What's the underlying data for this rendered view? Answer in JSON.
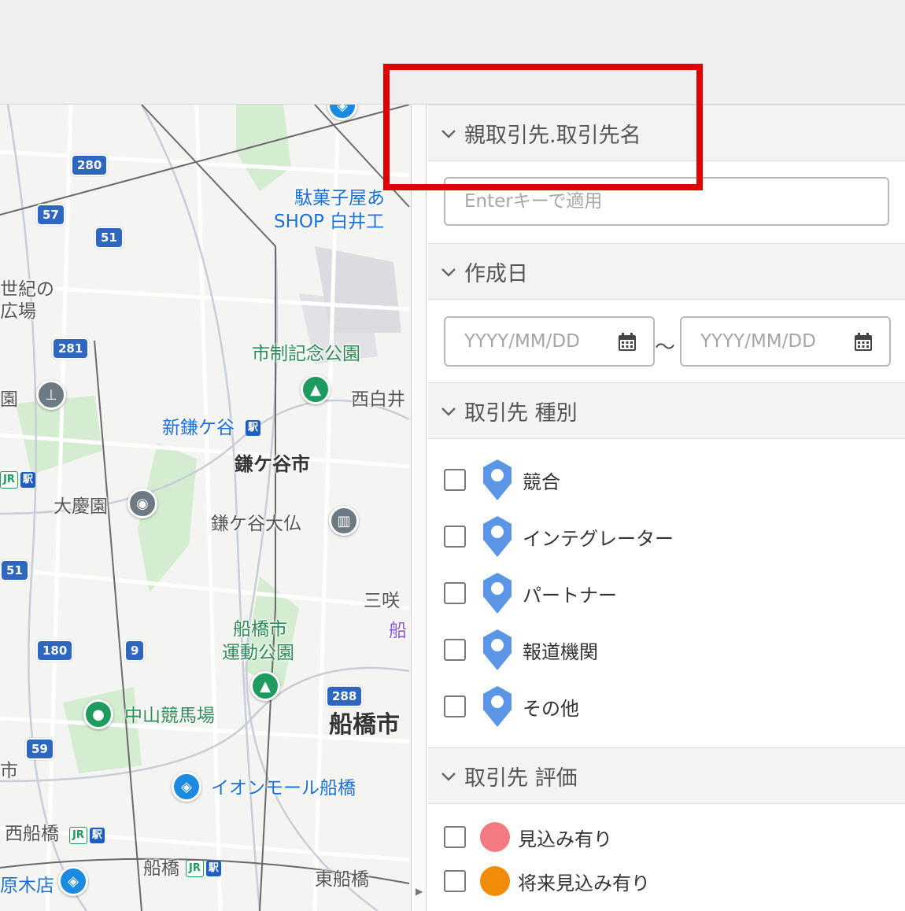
{
  "map": {
    "labels": {
      "dagashi": "駄菓子屋あ",
      "shop_shirai": "SHOP 白井工",
      "seiki": "世紀の",
      "hiroba": "広場",
      "shisei_park": "市制記念公園",
      "nishishirai": "西白井",
      "shin_kamagaya": "新鎌ケ谷",
      "kamagaya_city": "鎌ケ谷市",
      "en": "園",
      "taikeien": "大慶園",
      "kamagaya_daibutsu": "鎌ケ谷大仏",
      "sanzaki": "三咲",
      "funa_partial": "船",
      "funabashi_park_1": "船橋市",
      "funabashi_park_2": "運動公園",
      "nakayama": "中山競馬場",
      "funabashi_city": "船橋市",
      "aeon": "イオンモール船橋",
      "nishi_funabashi": "西船橋",
      "funabashi": "船橋",
      "higashi_funabashi": "東船橋",
      "kitenten": "原木店",
      "shi_partial": "市"
    },
    "routes": [
      "280",
      "57",
      "51",
      "281",
      "51",
      "180",
      "9",
      "288",
      "59"
    ]
  },
  "filters": {
    "parent_account": {
      "title": "親取引先.取引先名",
      "placeholder": "Enterキーで適用"
    },
    "created_date": {
      "title": "作成日",
      "from_placeholder": "YYYY/MM/DD",
      "to_placeholder": "YYYY/MM/DD",
      "separator": "〜"
    },
    "account_type": {
      "title": "取引先 種別",
      "items": [
        {
          "label": "競合",
          "color": "#5b95e6"
        },
        {
          "label": "インテグレーター",
          "color": "#5b95e6"
        },
        {
          "label": "パートナー",
          "color": "#5b95e6"
        },
        {
          "label": "報道機関",
          "color": "#5b95e6"
        },
        {
          "label": "その他",
          "color": "#5b95e6"
        }
      ]
    },
    "account_rating": {
      "title": "取引先 評価",
      "items": [
        {
          "label": "見込み有り",
          "color": "#f47a82"
        },
        {
          "label": "将来見込み有り",
          "color": "#f08c0a"
        }
      ]
    }
  }
}
